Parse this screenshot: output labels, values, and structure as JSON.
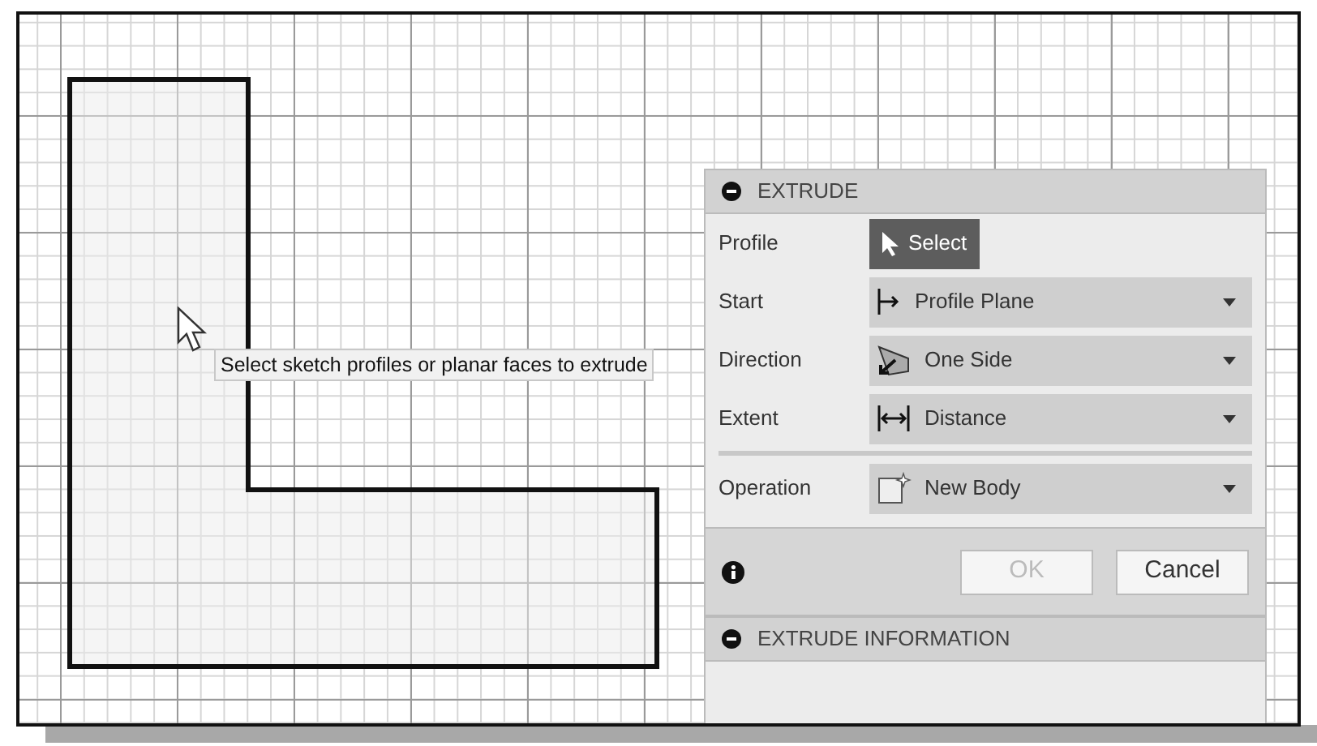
{
  "tooltip": {
    "text": "Select sketch profiles or planar faces to extrude"
  },
  "extrude_dialog": {
    "title": "EXTRUDE",
    "expanded": true,
    "rows": [
      {
        "label": "Profile",
        "kind": "button",
        "value": "Select"
      },
      {
        "label": "Start",
        "kind": "dropdown",
        "value": "Profile Plane"
      },
      {
        "label": "Direction",
        "kind": "dropdown",
        "value": "One Side"
      },
      {
        "label": "Extent",
        "kind": "dropdown",
        "value": "Distance"
      },
      {
        "label": "Operation",
        "kind": "dropdown",
        "value": "New Body"
      }
    ],
    "buttons": [
      {
        "label": "OK",
        "disabled": true
      },
      {
        "label": "Cancel",
        "disabled": false
      }
    ]
  },
  "info_panel": {
    "title": "EXTRUDE INFORMATION",
    "expanded": true
  }
}
